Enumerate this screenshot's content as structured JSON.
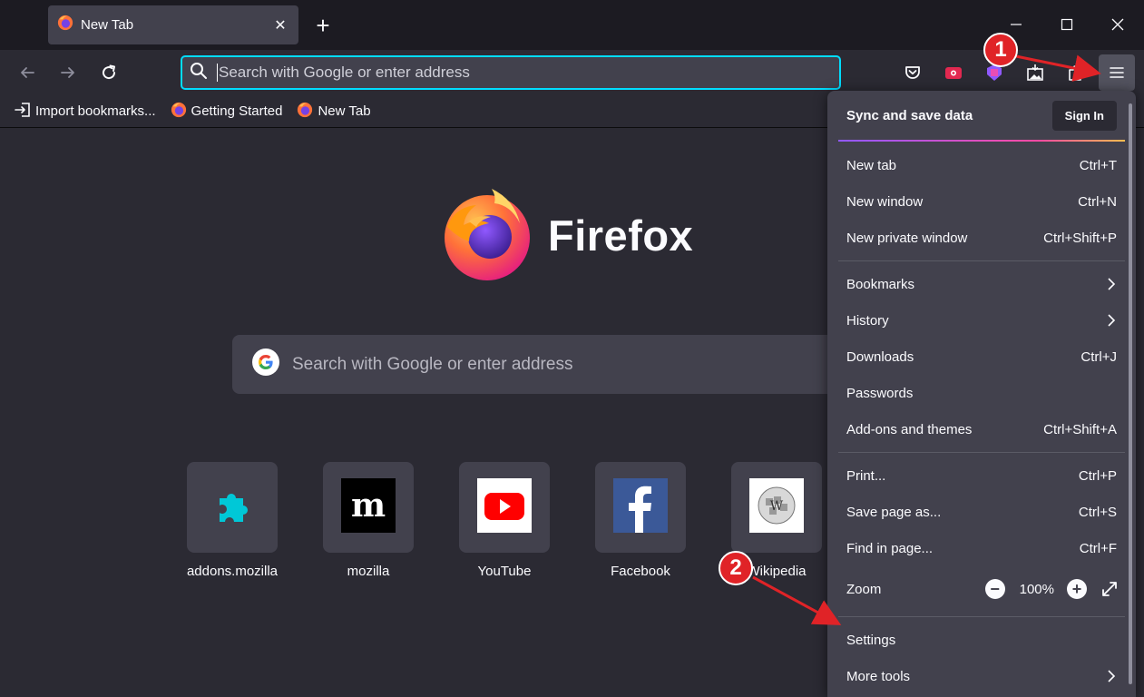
{
  "window": {
    "tab_title": "New Tab",
    "tab_close": "✕"
  },
  "navbar": {
    "url_placeholder": "Search with Google or enter address"
  },
  "bookmarks": [
    {
      "label": "Import bookmarks...",
      "icon": "import-icon"
    },
    {
      "label": "Getting Started",
      "icon": "firefox-icon"
    },
    {
      "label": "New Tab",
      "icon": "firefox-icon"
    }
  ],
  "content": {
    "logo_text": "Firefox",
    "search_placeholder": "Search with Google or enter address",
    "top_sites": [
      {
        "label": "addons.mozilla",
        "icon": "puzzle-icon"
      },
      {
        "label": "mozilla",
        "icon": "mozilla-m-icon"
      },
      {
        "label": "YouTube",
        "icon": "youtube-icon"
      },
      {
        "label": "Facebook",
        "icon": "facebook-icon"
      },
      {
        "label": "Wikipedia",
        "icon": "wikipedia-icon"
      }
    ]
  },
  "appmenu": {
    "sync_title": "Sync and save data",
    "sign_in": "Sign In",
    "group1": [
      {
        "label": "New tab",
        "shortcut": "Ctrl+T"
      },
      {
        "label": "New window",
        "shortcut": "Ctrl+N"
      },
      {
        "label": "New private window",
        "shortcut": "Ctrl+Shift+P"
      }
    ],
    "group2": [
      {
        "label": "Bookmarks",
        "shortcut": ""
      },
      {
        "label": "History",
        "shortcut": ""
      },
      {
        "label": "Downloads",
        "shortcut": "Ctrl+J"
      },
      {
        "label": "Passwords",
        "shortcut": ""
      },
      {
        "label": "Add-ons and themes",
        "shortcut": "Ctrl+Shift+A"
      }
    ],
    "group3": [
      {
        "label": "Print...",
        "shortcut": "Ctrl+P"
      },
      {
        "label": "Save page as...",
        "shortcut": "Ctrl+S"
      },
      {
        "label": "Find in page...",
        "shortcut": "Ctrl+F"
      }
    ],
    "zoom_label": "Zoom",
    "zoom_value": "100%",
    "zoom_minus": "−",
    "zoom_plus": "+",
    "group4": [
      {
        "label": "Settings",
        "shortcut": ""
      },
      {
        "label": "More tools",
        "shortcut": ""
      }
    ]
  },
  "annotations": {
    "step1": "1",
    "step2": "2",
    "color": "#e02327"
  },
  "colors": {
    "accent": "#00ddff",
    "background": "#2b2a33",
    "surface": "#42414d"
  }
}
